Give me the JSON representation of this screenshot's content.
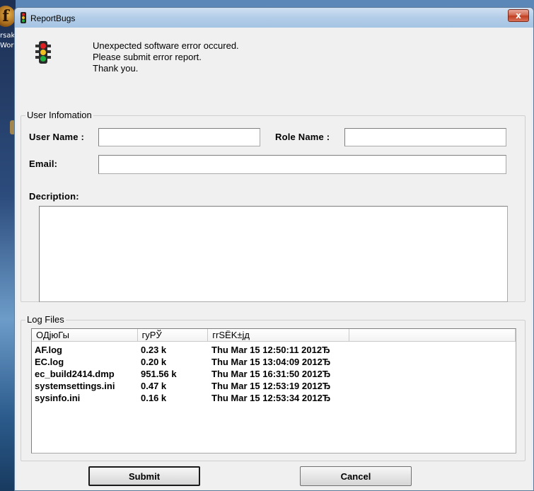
{
  "desktop": {
    "icon_glyph": "f",
    "text_lines": [
      "rsak",
      "Worl"
    ]
  },
  "window": {
    "title": "ReportBugs",
    "close_label": "x"
  },
  "message": {
    "line1": "Unexpected software error occured.",
    "line2": "Please submit error report.",
    "line3": "Thank you."
  },
  "user_info": {
    "group_title": "User Infomation",
    "user_name_label": "User Name :",
    "user_name_value": "",
    "role_name_label": "Role Name :",
    "role_name_value": "",
    "email_label": "Email:",
    "email_value": "",
    "description_label": "Decription:",
    "description_value": ""
  },
  "log_files": {
    "group_title": "Log Files",
    "columns": [
      "ОДјюГы",
      "гуРЎ",
      "гrSЁK±jд"
    ],
    "rows": [
      {
        "name": "AF.log",
        "size": "0.23 k",
        "date": "Thu Mar 15 12:50:11 2012Ђ"
      },
      {
        "name": "EC.log",
        "size": "0.20 k",
        "date": "Thu Mar 15 13:04:09 2012Ђ"
      },
      {
        "name": "ec_build2414.dmp",
        "size": "951.56 k",
        "date": "Thu Mar 15 16:31:50 2012Ђ"
      },
      {
        "name": "systemsettings.ini",
        "size": "0.47 k",
        "date": "Thu Mar 15 12:53:19 2012Ђ"
      },
      {
        "name": "sysinfo.ini",
        "size": "0.16 k",
        "date": "Thu Mar 15 12:53:34 2012Ђ"
      }
    ]
  },
  "buttons": {
    "submit": "Submit",
    "cancel": "Cancel"
  },
  "colors": {
    "traffic_red": "#e02020",
    "traffic_yellow": "#f0c020",
    "traffic_green": "#20b040"
  }
}
